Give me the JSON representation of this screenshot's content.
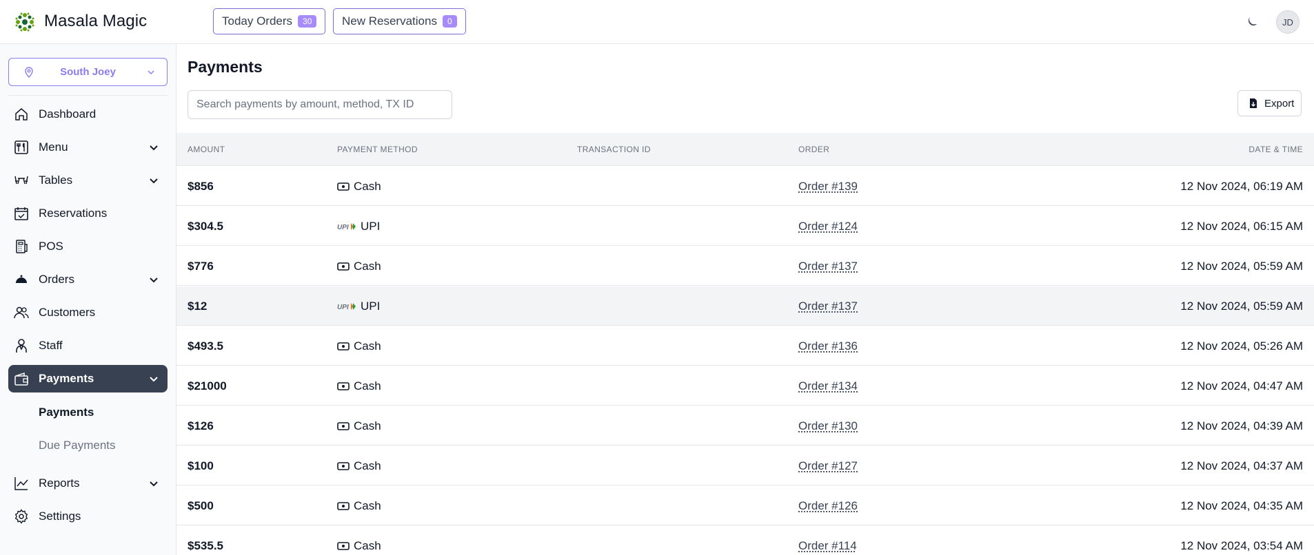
{
  "app": {
    "brand": "Masala Magic",
    "user_initials": "JD"
  },
  "header": {
    "today_orders_label": "Today Orders",
    "today_orders_count": "30",
    "new_reservations_label": "New Reservations",
    "new_reservations_count": "0"
  },
  "sidebar": {
    "location": "South Joey",
    "items": [
      {
        "label": "Dashboard"
      },
      {
        "label": "Menu"
      },
      {
        "label": "Tables"
      },
      {
        "label": "Reservations"
      },
      {
        "label": "POS"
      },
      {
        "label": "Orders"
      },
      {
        "label": "Customers"
      },
      {
        "label": "Staff"
      },
      {
        "label": "Payments"
      },
      {
        "label": "Reports"
      },
      {
        "label": "Settings"
      }
    ],
    "payments_sub": [
      {
        "label": "Payments"
      },
      {
        "label": "Due Payments"
      }
    ]
  },
  "main": {
    "title": "Payments",
    "search_placeholder": "Search payments by amount, method, TX ID",
    "export_label": "Export",
    "columns": {
      "amount": "AMOUNT",
      "method": "PAYMENT METHOD",
      "txid": "TRANSACTION ID",
      "order": "ORDER",
      "datetime": "DATE & TIME"
    },
    "rows": [
      {
        "amount": "$856",
        "method": "Cash",
        "order": "Order #139",
        "datetime": "12 Nov 2024, 06:19 AM"
      },
      {
        "amount": "$304.5",
        "method": "UPI",
        "order": "Order #124",
        "datetime": "12 Nov 2024, 06:15 AM"
      },
      {
        "amount": "$776",
        "method": "Cash",
        "order": "Order #137",
        "datetime": "12 Nov 2024, 05:59 AM"
      },
      {
        "amount": "$12",
        "method": "UPI",
        "order": "Order #137",
        "datetime": "12 Nov 2024, 05:59 AM"
      },
      {
        "amount": "$493.5",
        "method": "Cash",
        "order": "Order #136",
        "datetime": "12 Nov 2024, 05:26 AM"
      },
      {
        "amount": "$21000",
        "method": "Cash",
        "order": "Order #134",
        "datetime": "12 Nov 2024, 04:47 AM"
      },
      {
        "amount": "$126",
        "method": "Cash",
        "order": "Order #130",
        "datetime": "12 Nov 2024, 04:39 AM"
      },
      {
        "amount": "$100",
        "method": "Cash",
        "order": "Order #127",
        "datetime": "12 Nov 2024, 04:37 AM"
      },
      {
        "amount": "$500",
        "method": "Cash",
        "order": "Order #126",
        "datetime": "12 Nov 2024, 04:35 AM"
      },
      {
        "amount": "$535.5",
        "method": "Cash",
        "order": "Order #114",
        "datetime": "12 Nov 2024, 03:54 AM"
      }
    ]
  },
  "colors": {
    "accent": "#8b7cf0",
    "badge": "#a78bfa",
    "active_nav": "#374151"
  }
}
